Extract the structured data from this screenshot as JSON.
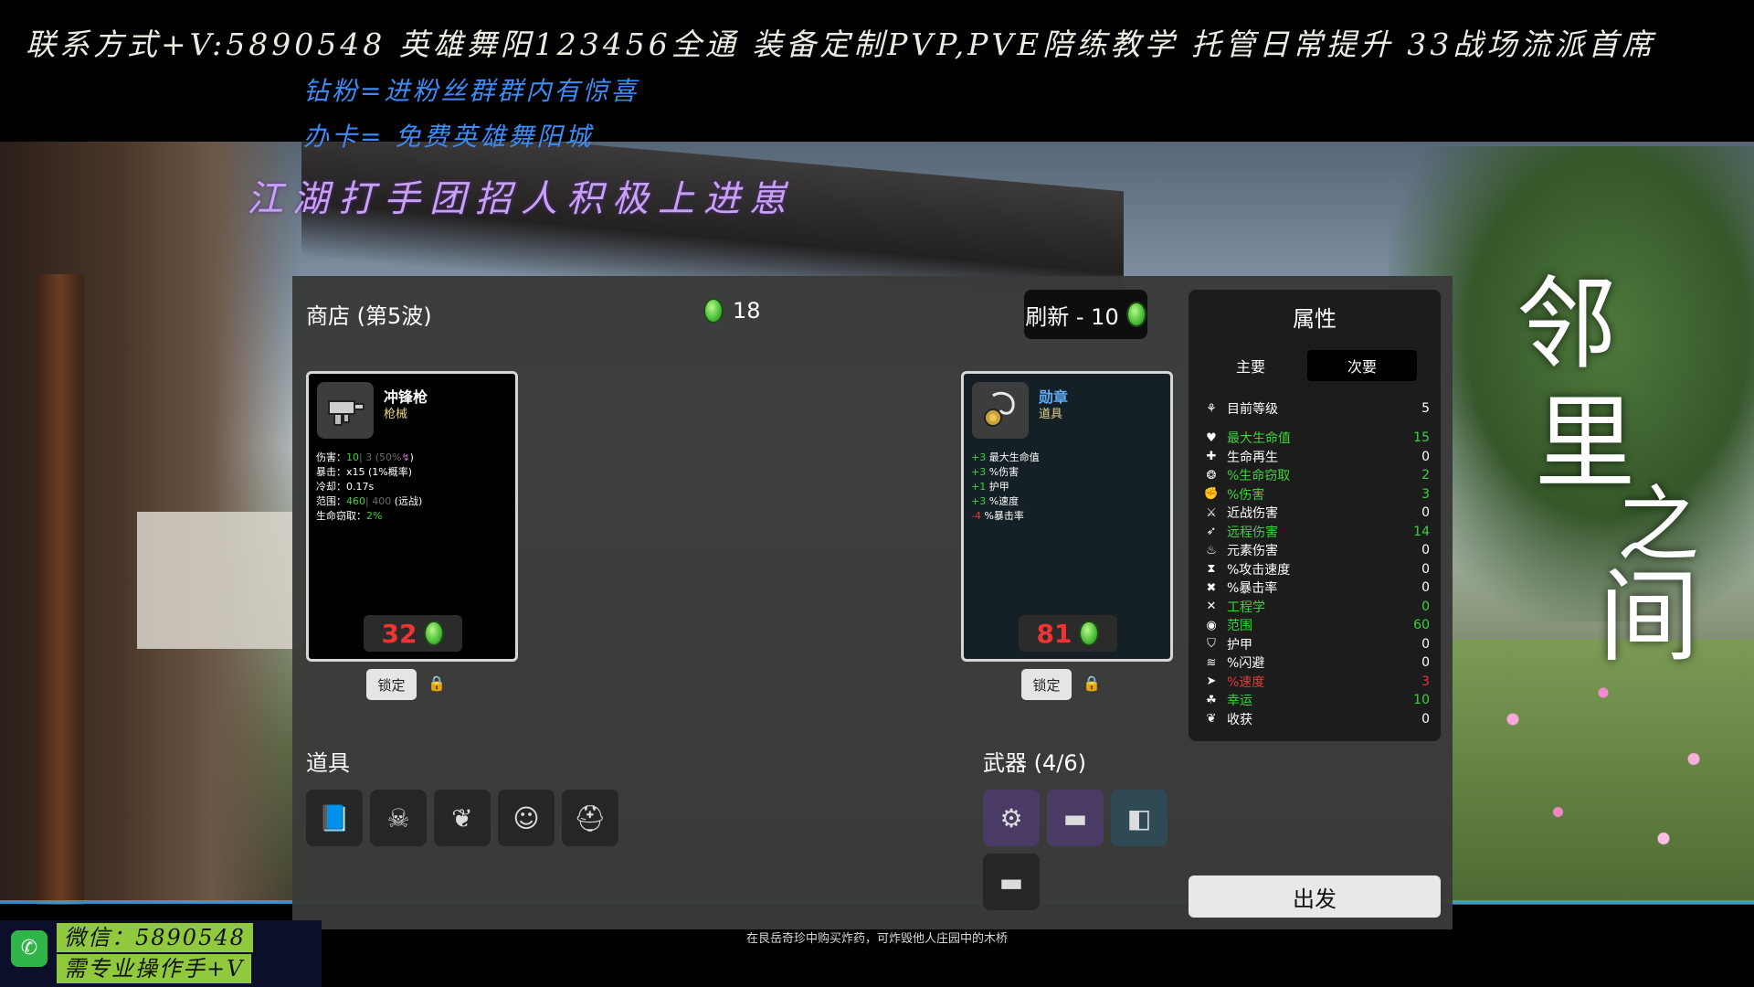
{
  "overlay": {
    "top_line": "联系方式+V:5890548 英雄舞阳123456全通 装备定制PVP,PVE陪练教学 托管日常提升 33战场流派首席",
    "promo1": "钻粉=进粉丝群群内有惊喜",
    "promo2": "办卡=      免费英雄舞阳城",
    "recruit": "江湖打手团招人积极上进崽",
    "calligraphy": [
      "邻",
      "里",
      "之",
      "间"
    ],
    "wechat_line1": "微信：5890548",
    "wechat_line2": "需专业操作手+V",
    "bottom_tip": "在艮岳奇珍中购买炸药，可炸毁他人庄园中的木桥"
  },
  "shop": {
    "title": "商店 (第5波)",
    "gold": "18",
    "refresh_label": "刷新 - 10",
    "lock_label": "锁定",
    "cards": [
      {
        "name": "冲锋枪",
        "category": "枪械",
        "icon": "smg-icon",
        "stats": [
          {
            "label": "伤害：",
            "value": "10",
            "extra": "| 3 (50%",
            "tail": ")"
          },
          {
            "label": "暴击：",
            "value": "x15 (1%概率)"
          },
          {
            "label": "冷却：",
            "value": "0.17s"
          },
          {
            "label": "范围：",
            "value": "460",
            "extra": "| 400",
            "tail": " (远战)"
          },
          {
            "label": "生命窃取：",
            "value": "2%"
          }
        ],
        "price": "32"
      },
      {
        "name": "勋章",
        "category": "道具",
        "icon": "medal-icon",
        "effects": [
          {
            "sign": "+3",
            "text": "最大生命值",
            "color": "green"
          },
          {
            "sign": "+3",
            "text": "%伤害",
            "color": "green"
          },
          {
            "sign": "+1",
            "text": "护甲",
            "color": "green"
          },
          {
            "sign": "+3",
            "text": "%速度",
            "color": "green"
          },
          {
            "sign": "-4",
            "text": "%暴击率",
            "color": "red"
          }
        ],
        "price": "81"
      }
    ],
    "items_title": "道具",
    "items": [
      "book-icon",
      "skull-mask-icon",
      "butterfly-icon",
      "ghost-icon",
      "propeller-hat-icon"
    ],
    "weapons_title": "武器 (4/6)",
    "weapons": [
      "minigun-icon",
      "smg-icon",
      "laser-gun-icon",
      "smg-icon"
    ]
  },
  "stats_panel": {
    "title": "属性",
    "tab_primary": "主要",
    "tab_secondary": "次要",
    "level_label": "目前等级",
    "level_value": "5",
    "rows": [
      {
        "label": "最大生命值",
        "value": "15",
        "color": "green",
        "icon": "heart-icon"
      },
      {
        "label": "生命再生",
        "value": "0",
        "color": "white",
        "icon": "regen-icon"
      },
      {
        "label": "%生命窃取",
        "value": "2",
        "color": "green",
        "icon": "lifesteal-icon"
      },
      {
        "label": "%伤害",
        "value": "3",
        "color": "green",
        "icon": "damage-icon"
      },
      {
        "label": "近战伤害",
        "value": "0",
        "color": "white",
        "icon": "melee-icon"
      },
      {
        "label": "远程伤害",
        "value": "14",
        "color": "green",
        "icon": "ranged-icon"
      },
      {
        "label": "元素伤害",
        "value": "0",
        "color": "white",
        "icon": "fire-icon"
      },
      {
        "label": "%攻击速度",
        "value": "0",
        "color": "white",
        "icon": "attack-speed-icon"
      },
      {
        "label": "%暴击率",
        "value": "0",
        "color": "white",
        "icon": "crit-icon"
      },
      {
        "label": "工程学",
        "value": "0",
        "color": "green",
        "icon": "engineering-icon"
      },
      {
        "label": "范围",
        "value": "60",
        "color": "green",
        "icon": "range-icon"
      },
      {
        "label": "护甲",
        "value": "0",
        "color": "white",
        "icon": "armor-icon"
      },
      {
        "label": "%闪避",
        "value": "0",
        "color": "white",
        "icon": "dodge-icon"
      },
      {
        "label": "%速度",
        "value": "3",
        "color": "red",
        "icon": "speed-icon"
      },
      {
        "label": "幸运",
        "value": "10",
        "color": "green",
        "icon": "luck-icon"
      },
      {
        "label": "收获",
        "value": "0",
        "color": "white",
        "icon": "harvest-icon"
      }
    ],
    "go_label": "出发"
  }
}
